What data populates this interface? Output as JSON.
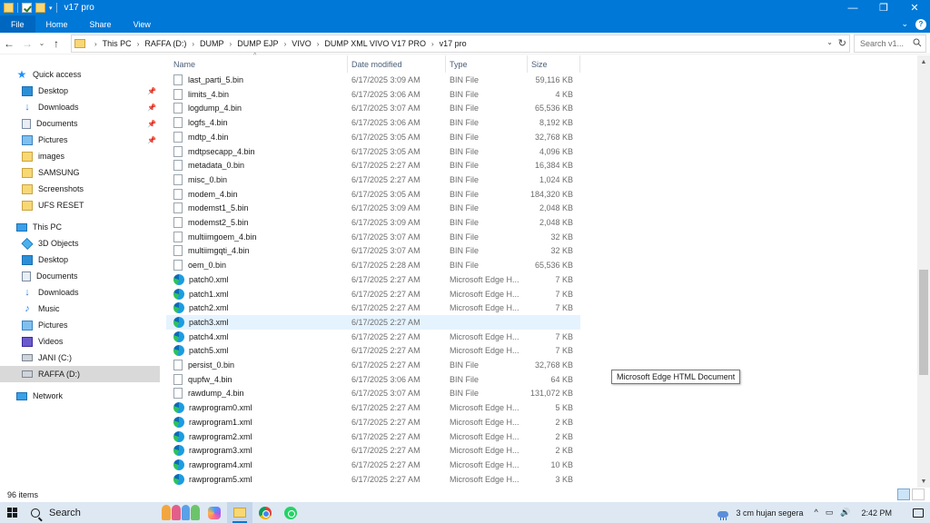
{
  "window": {
    "title": "v17 pro",
    "controls": {
      "minimize": "—",
      "maximize": "❐",
      "close": "✕"
    }
  },
  "ribbon": {
    "tabs": [
      "File",
      "Home",
      "Share",
      "View"
    ],
    "expand": "⌄",
    "help": "?"
  },
  "address": {
    "breadcrumbs": [
      "This PC",
      "RAFFA (D:)",
      "DUMP",
      "DUMP EJP",
      "VIVO",
      "DUMP XML VIVO V17 PRO",
      "v17 pro"
    ],
    "search_placeholder": "Search v1..."
  },
  "sidebar": {
    "quick_access_label": "Quick access",
    "quick_access": [
      {
        "label": "Desktop",
        "icon": "desktop-icon",
        "pinned": true
      },
      {
        "label": "Downloads",
        "icon": "download-icon",
        "pinned": true
      },
      {
        "label": "Documents",
        "icon": "documents-icon",
        "pinned": true
      },
      {
        "label": "Pictures",
        "icon": "pictures-icon",
        "pinned": true
      },
      {
        "label": "images",
        "icon": "folder-icon",
        "pinned": false
      },
      {
        "label": "SAMSUNG",
        "icon": "folder-icon",
        "pinned": false
      },
      {
        "label": "Screenshots",
        "icon": "folder-icon",
        "pinned": false
      },
      {
        "label": "UFS RESET",
        "icon": "folder-icon",
        "pinned": false
      }
    ],
    "this_pc_label": "This PC",
    "this_pc": [
      {
        "label": "3D Objects",
        "icon": "3d-objects-icon"
      },
      {
        "label": "Desktop",
        "icon": "desktop-icon"
      },
      {
        "label": "Documents",
        "icon": "documents-icon"
      },
      {
        "label": "Downloads",
        "icon": "download-icon"
      },
      {
        "label": "Music",
        "icon": "music-icon"
      },
      {
        "label": "Pictures",
        "icon": "pictures-icon"
      },
      {
        "label": "Videos",
        "icon": "videos-icon"
      },
      {
        "label": "JANI (C:)",
        "icon": "drive-icon"
      },
      {
        "label": "RAFFA (D:)",
        "icon": "drive-icon",
        "selected": true
      }
    ],
    "network_label": "Network"
  },
  "columns": {
    "name": "Name",
    "date": "Date modified",
    "type": "Type",
    "size": "Size"
  },
  "files": [
    {
      "name": "last_parti_5.bin",
      "date": "6/17/2025 3:09 AM",
      "type": "BIN File",
      "size": "59,116 KB",
      "icon": "bin"
    },
    {
      "name": "limits_4.bin",
      "date": "6/17/2025 3:06 AM",
      "type": "BIN File",
      "size": "4 KB",
      "icon": "bin"
    },
    {
      "name": "logdump_4.bin",
      "date": "6/17/2025 3:07 AM",
      "type": "BIN File",
      "size": "65,536 KB",
      "icon": "bin"
    },
    {
      "name": "logfs_4.bin",
      "date": "6/17/2025 3:06 AM",
      "type": "BIN File",
      "size": "8,192 KB",
      "icon": "bin"
    },
    {
      "name": "mdtp_4.bin",
      "date": "6/17/2025 3:05 AM",
      "type": "BIN File",
      "size": "32,768 KB",
      "icon": "bin"
    },
    {
      "name": "mdtpsecapp_4.bin",
      "date": "6/17/2025 3:05 AM",
      "type": "BIN File",
      "size": "4,096 KB",
      "icon": "bin"
    },
    {
      "name": "metadata_0.bin",
      "date": "6/17/2025 2:27 AM",
      "type": "BIN File",
      "size": "16,384 KB",
      "icon": "bin"
    },
    {
      "name": "misc_0.bin",
      "date": "6/17/2025 2:27 AM",
      "type": "BIN File",
      "size": "1,024 KB",
      "icon": "bin"
    },
    {
      "name": "modem_4.bin",
      "date": "6/17/2025 3:05 AM",
      "type": "BIN File",
      "size": "184,320 KB",
      "icon": "bin"
    },
    {
      "name": "modemst1_5.bin",
      "date": "6/17/2025 3:09 AM",
      "type": "BIN File",
      "size": "2,048 KB",
      "icon": "bin"
    },
    {
      "name": "modemst2_5.bin",
      "date": "6/17/2025 3:09 AM",
      "type": "BIN File",
      "size": "2,048 KB",
      "icon": "bin"
    },
    {
      "name": "multiimgoem_4.bin",
      "date": "6/17/2025 3:07 AM",
      "type": "BIN File",
      "size": "32 KB",
      "icon": "bin"
    },
    {
      "name": "multiimgqti_4.bin",
      "date": "6/17/2025 3:07 AM",
      "type": "BIN File",
      "size": "32 KB",
      "icon": "bin"
    },
    {
      "name": "oem_0.bin",
      "date": "6/17/2025 2:28 AM",
      "type": "BIN File",
      "size": "65,536 KB",
      "icon": "bin"
    },
    {
      "name": "patch0.xml",
      "date": "6/17/2025 2:27 AM",
      "type": "Microsoft Edge H...",
      "size": "7 KB",
      "icon": "edge"
    },
    {
      "name": "patch1.xml",
      "date": "6/17/2025 2:27 AM",
      "type": "Microsoft Edge H...",
      "size": "7 KB",
      "icon": "edge"
    },
    {
      "name": "patch2.xml",
      "date": "6/17/2025 2:27 AM",
      "type": "Microsoft Edge H...",
      "size": "7 KB",
      "icon": "edge"
    },
    {
      "name": "patch3.xml",
      "date": "6/17/2025 2:27 AM",
      "type": "",
      "size": "",
      "icon": "edge",
      "hover": true
    },
    {
      "name": "patch4.xml",
      "date": "6/17/2025 2:27 AM",
      "type": "Microsoft Edge H...",
      "size": "7 KB",
      "icon": "edge"
    },
    {
      "name": "patch5.xml",
      "date": "6/17/2025 2:27 AM",
      "type": "Microsoft Edge H...",
      "size": "7 KB",
      "icon": "edge"
    },
    {
      "name": "persist_0.bin",
      "date": "6/17/2025 2:27 AM",
      "type": "BIN File",
      "size": "32,768 KB",
      "icon": "bin"
    },
    {
      "name": "qupfw_4.bin",
      "date": "6/17/2025 3:06 AM",
      "type": "BIN File",
      "size": "64 KB",
      "icon": "bin"
    },
    {
      "name": "rawdump_4.bin",
      "date": "6/17/2025 3:07 AM",
      "type": "BIN File",
      "size": "131,072 KB",
      "icon": "bin"
    },
    {
      "name": "rawprogram0.xml",
      "date": "6/17/2025 2:27 AM",
      "type": "Microsoft Edge H...",
      "size": "5 KB",
      "icon": "edge"
    },
    {
      "name": "rawprogram1.xml",
      "date": "6/17/2025 2:27 AM",
      "type": "Microsoft Edge H...",
      "size": "2 KB",
      "icon": "edge"
    },
    {
      "name": "rawprogram2.xml",
      "date": "6/17/2025 2:27 AM",
      "type": "Microsoft Edge H...",
      "size": "2 KB",
      "icon": "edge"
    },
    {
      "name": "rawprogram3.xml",
      "date": "6/17/2025 2:27 AM",
      "type": "Microsoft Edge H...",
      "size": "2 KB",
      "icon": "edge"
    },
    {
      "name": "rawprogram4.xml",
      "date": "6/17/2025 2:27 AM",
      "type": "Microsoft Edge H...",
      "size": "10 KB",
      "icon": "edge"
    },
    {
      "name": "rawprogram5.xml",
      "date": "6/17/2025 2:27 AM",
      "type": "Microsoft Edge H...",
      "size": "3 KB",
      "icon": "edge"
    }
  ],
  "tooltip": "Microsoft Edge HTML Document",
  "status": {
    "item_count": "96 items"
  },
  "taskbar": {
    "search_label": "Search",
    "weather": "3 cm hujan segera",
    "time": "2:42 PM",
    "tray": [
      "^",
      "▭",
      "🔊"
    ]
  },
  "colors": {
    "accent": "#0078d7",
    "hover_row": "#e5f3ff",
    "selected_nav": "#d9d9d9"
  }
}
